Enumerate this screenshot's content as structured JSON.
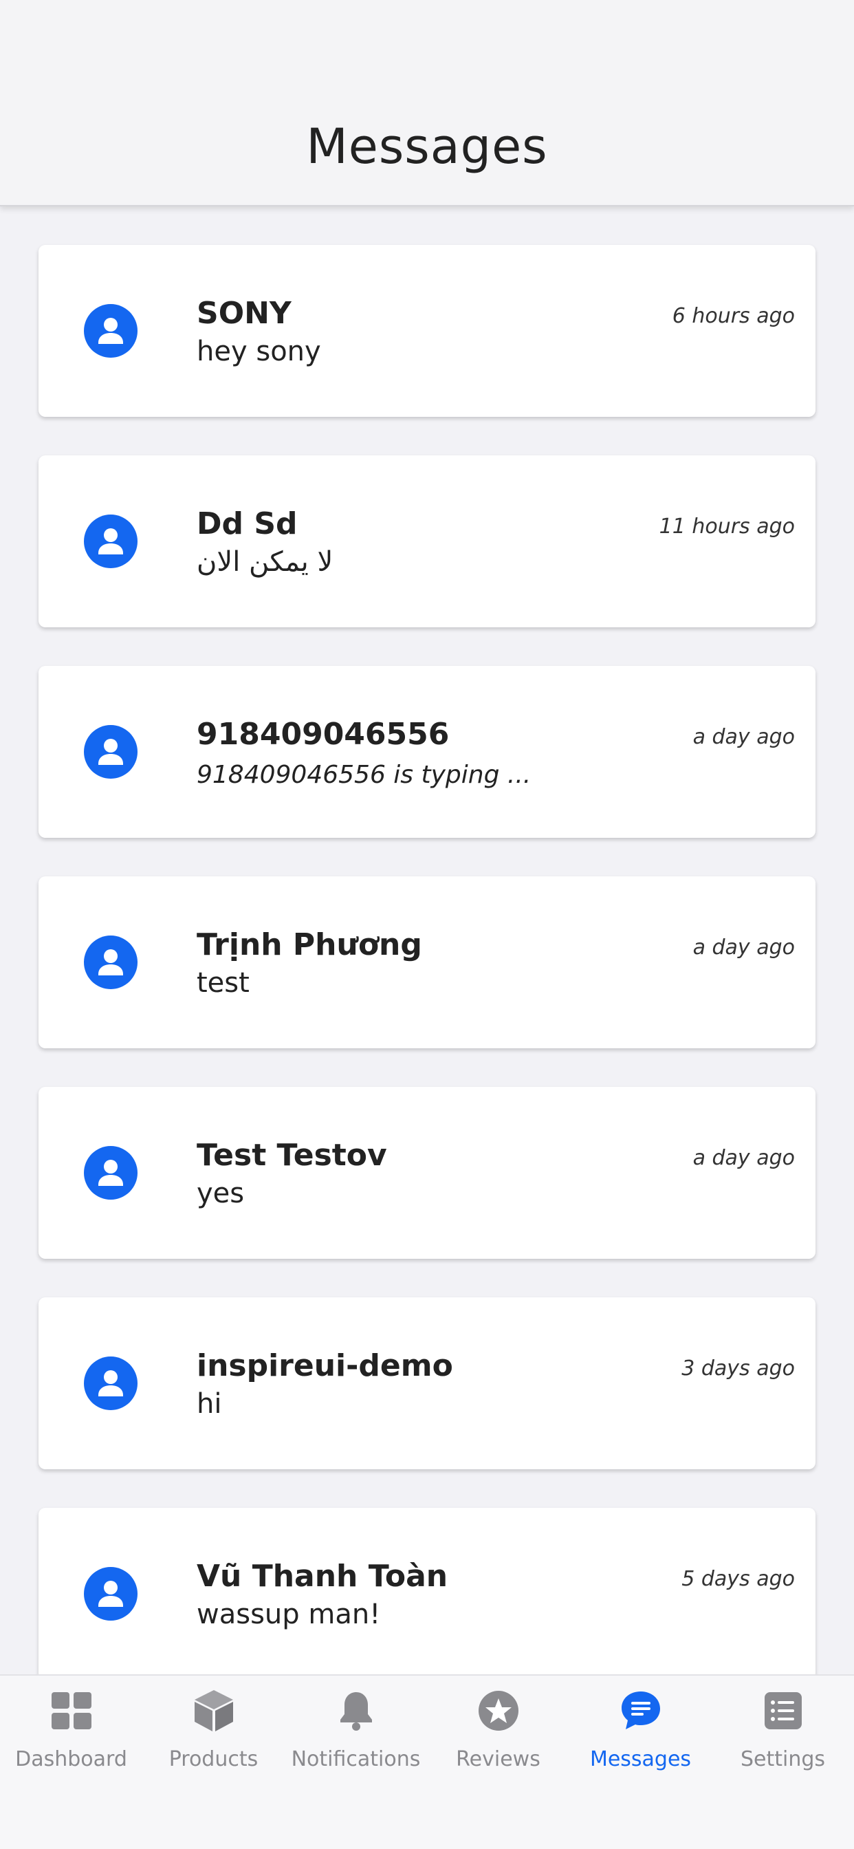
{
  "header": {
    "title": "Messages"
  },
  "conversations": [
    {
      "name": "SONY",
      "message": "hey sony",
      "time": "6 hours ago",
      "italic": false
    },
    {
      "name": "Dd Sd",
      "message": "لا يمكن الان",
      "time": "11 hours ago",
      "italic": false
    },
    {
      "name": "918409046556",
      "message": "918409046556 is typing ...",
      "time": "a day ago",
      "italic": true
    },
    {
      "name": "Trịnh Phương",
      "message": "test",
      "time": "a day ago",
      "italic": false
    },
    {
      "name": "Test Testov",
      "message": "yes",
      "time": "a day ago",
      "italic": false
    },
    {
      "name": "inspireui-demo",
      "message": "hi",
      "time": "3 days ago",
      "italic": false
    },
    {
      "name": "Vũ Thanh Toàn",
      "message": "wassup man!",
      "time": "5 days ago",
      "italic": false
    }
  ],
  "tabs": [
    {
      "label": "Dashboard",
      "icon": "dashboard-icon"
    },
    {
      "label": "Products",
      "icon": "cube-icon"
    },
    {
      "label": "Notifications",
      "icon": "bell-icon"
    },
    {
      "label": "Reviews",
      "icon": "star-icon"
    },
    {
      "label": "Messages",
      "icon": "chat-icon",
      "active": true
    },
    {
      "label": "Settings",
      "icon": "list-icon"
    }
  ],
  "colors": {
    "accent": "#1467f0",
    "inactive": "#8a8a8e",
    "background": "#f2f2f6"
  }
}
